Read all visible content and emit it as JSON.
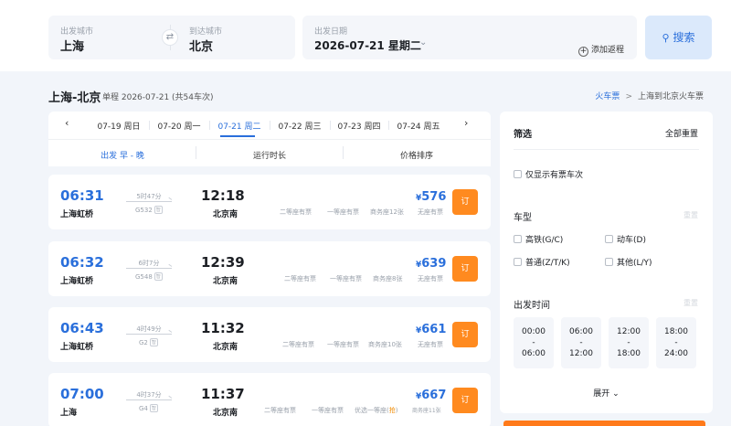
{
  "search": {
    "from_label": "出发城市",
    "from_city": "上海",
    "to_label": "到达城市",
    "to_city": "北京",
    "swap_icon": "⇄",
    "date_label": "出发日期",
    "date_value": "2026-07-21  星期二",
    "date_chevron": "⌄",
    "add_return": "添加返程",
    "search_button": "搜索"
  },
  "header": {
    "route": "上海-北京",
    "meta": "单程 2026-07-21 (共54车次)",
    "crumb_link": "火车票",
    "crumb_sep": ">",
    "crumb_current": "上海到北京火车票"
  },
  "date_tabs": [
    {
      "label": "07-19 周日",
      "active": false
    },
    {
      "label": "07-20 周一",
      "active": false
    },
    {
      "label": "07-21 周二",
      "active": true
    },
    {
      "label": "07-22 周三",
      "active": false
    },
    {
      "label": "07-23 周四",
      "active": false
    },
    {
      "label": "07-24 周五",
      "active": false
    }
  ],
  "sort": {
    "depart": "出发 早 - 晚",
    "duration": "运行时长",
    "price": "价格排序"
  },
  "trains": [
    {
      "dep_time": "06:31",
      "dep_station": "上海虹桥",
      "duration": "5时47分",
      "train_no": "G532",
      "arr_time": "12:18",
      "arr_station": "北京南",
      "seats": [
        "二等座有票",
        "一等座有票",
        "商务座12张"
      ],
      "price": "576",
      "no_seat": "无座有票",
      "book": "订"
    },
    {
      "dep_time": "06:32",
      "dep_station": "上海虹桥",
      "duration": "6时7分",
      "train_no": "G548",
      "arr_time": "12:39",
      "arr_station": "北京南",
      "seats": [
        "二等座有票",
        "一等座有票",
        "商务座8张"
      ],
      "price": "639",
      "no_seat": "无座有票",
      "book": "订"
    },
    {
      "dep_time": "06:43",
      "dep_station": "上海虹桥",
      "duration": "4时49分",
      "train_no": "G2",
      "arr_time": "11:32",
      "arr_station": "北京南",
      "seats": [
        "二等座有票",
        "一等座有票",
        "商务座10张"
      ],
      "price": "661",
      "no_seat": "无座有票",
      "book": "订"
    },
    {
      "dep_time": "07:00",
      "dep_station": "上海",
      "duration": "4时37分",
      "train_no": "G4",
      "arr_time": "11:37",
      "arr_station": "北京南",
      "seats": [
        "二等座有票",
        "一等座有票",
        "优选一等座(",
        "抢",
        ")",
        "商务座11张"
      ],
      "price": "667",
      "no_seat": "无座有票",
      "book": "订"
    }
  ],
  "tag_text": "智",
  "filter": {
    "title": "筛选",
    "reset_all": "全部重置",
    "only_available": "仅显示有票车次",
    "type_title": "车型",
    "type_clear": "重置",
    "types": [
      "高铁(G/C)",
      "动车(D)",
      "普通(Z/T/K)",
      "其他(L/Y)"
    ],
    "time_title": "出发时间",
    "time_clear": "重置",
    "time_slots": [
      {
        "start": "00:00",
        "dash": "-",
        "end": "06:00"
      },
      {
        "start": "06:00",
        "dash": "-",
        "end": "12:00"
      },
      {
        "start": "12:00",
        "dash": "-",
        "end": "18:00"
      },
      {
        "start": "18:00",
        "dash": "-",
        "end": "24:00"
      }
    ],
    "expand": "展开 ⌄"
  }
}
